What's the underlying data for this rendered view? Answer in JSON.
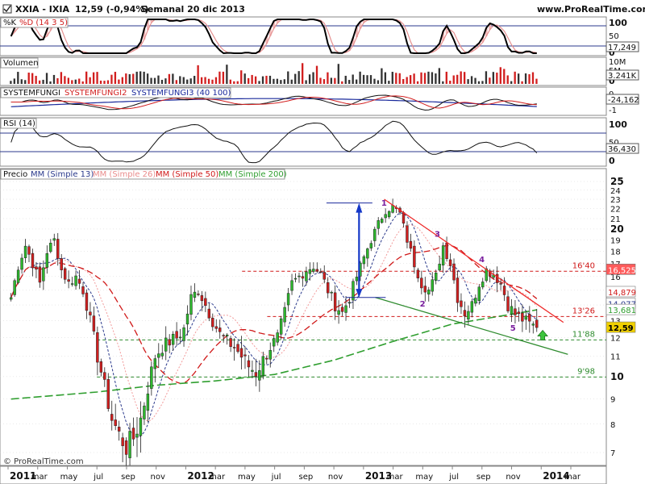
{
  "header": {
    "ticker_line": "XXIA - IXIA",
    "price_change": "12,59 (-0,94%)",
    "period_date": "Semanal  20 dic 2013",
    "site": "www.ProRealTime.com"
  },
  "copyright": "© ProRealTime.com",
  "stochastic": {
    "labels": [
      "%K",
      "%D (14 3 5)"
    ],
    "levels": [
      "100",
      "50",
      "0"
    ],
    "last_value": "17,249"
  },
  "volume": {
    "label": "Volumen",
    "levels": [
      "10M",
      "5M",
      "0"
    ],
    "last_value": "3.241K"
  },
  "systemfungi": {
    "labels": [
      "SYSTEMFUNGI",
      "SYSTEMFUNGI2",
      "SYSTEMFUNGI3 (40 100)"
    ],
    "levels": [
      "0",
      "-1"
    ],
    "last_value": "-24,162"
  },
  "rsi": {
    "label": "RSI (14)",
    "levels": [
      "100",
      "50",
      "0"
    ],
    "last_value": "36,430"
  },
  "price_panel": {
    "legend": [
      "Precio",
      "MM (Simple 13)",
      "MM (Simple 26)",
      "MM (Simple 50)",
      "MM (Simple 200)"
    ],
    "y_ticks": [
      "25",
      "24",
      "23",
      "22",
      "21",
      "20",
      "19",
      "18",
      "17",
      "16",
      "15",
      "14",
      "13",
      "12",
      "11",
      "10",
      "9",
      "8",
      "7"
    ],
    "level_labels": [
      "16'40",
      "13'26",
      "11'88",
      "9'98"
    ],
    "right_tags": [
      "16,525",
      "14,879",
      "14,077",
      "13,681",
      "12,59"
    ],
    "wave_labels": [
      "1",
      "2",
      "3",
      "4",
      "5"
    ]
  },
  "x_axis": {
    "labels": [
      "2011",
      "mar",
      "may",
      "jul",
      "sep",
      "nov",
      "2012",
      "mar",
      "may",
      "jul",
      "sep",
      "nov",
      "2013",
      "mar",
      "may",
      "jul",
      "sep",
      "nov",
      "2014",
      "mar"
    ]
  },
  "colors": {
    "up_candle": "#2db82d",
    "down_candle": "#d21f1f",
    "mm13": "#2b3a8c",
    "mm26": "#f29a9a",
    "mm50": "#d01a1a",
    "mm200": "#2f9e2f",
    "resistance": "#ee2a2a",
    "support": "#2e8b2e",
    "arrow": "#1538c8",
    "grid": "#d4d4d4"
  },
  "chart_data": {
    "type": "candlestick",
    "title": "XXIA - IXIA",
    "x_range": [
      "2011-01",
      "2014-03"
    ],
    "ylim": [
      6.5,
      25.5
    ],
    "y_scale": "log",
    "grid": true,
    "series": [
      {
        "name": "Precio",
        "weekly_close_approx": [
          14.5,
          16.8,
          18.5,
          17.0,
          15.5,
          18.0,
          19.0,
          16.5,
          15.5,
          16.0,
          15.0,
          13.0,
          11.0,
          9.5,
          8.2,
          7.6,
          7.2,
          7.5,
          8.2,
          9.5,
          11.0,
          11.5,
          11.8,
          12.0,
          12.5,
          14.5,
          15.0,
          14.0,
          13.0,
          12.2,
          11.8,
          11.5,
          11.0,
          10.5,
          10.2,
          10.8,
          11.5,
          12.0,
          13.5,
          15.5,
          16.0,
          16.5,
          16.8,
          16.2,
          15.0,
          14.0,
          13.5,
          14.5,
          16.0,
          17.5,
          19.0,
          20.5,
          21.8,
          22.2,
          21.5,
          19.0,
          17.0,
          15.5,
          15.0,
          16.0,
          18.5,
          17.0,
          14.5,
          13.5,
          14.0,
          15.5,
          16.5,
          16.2,
          15.5,
          14.0,
          13.4,
          13.1,
          12.8,
          12.59
        ]
      },
      {
        "name": "MM (Simple 13)",
        "last_value": 14.077
      },
      {
        "name": "MM (Simple 26)",
        "last_value": 14.879
      },
      {
        "name": "MM (Simple 50)",
        "last_value": 16.525
      },
      {
        "name": "MM (Simple 200)",
        "last_value": 13.681
      }
    ],
    "horizontal_levels": [
      16.4,
      13.26,
      11.88,
      9.98
    ],
    "indicators": {
      "stochastic_last": 17.249,
      "volume_last": "3.241K",
      "systemfungi_last": -24.162,
      "rsi_last": 36.43
    }
  }
}
